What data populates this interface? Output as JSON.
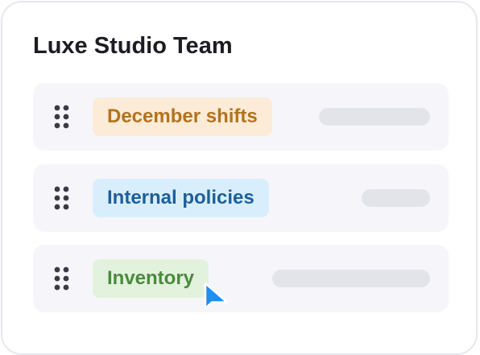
{
  "card": {
    "title": "Luxe Studio Team"
  },
  "rows": [
    {
      "label": "December shifts",
      "color": "#b2731e",
      "background": "#fcebd6"
    },
    {
      "label": "Internal policies",
      "color": "#1d5f99",
      "background": "#d9eefd"
    },
    {
      "label": "Inventory",
      "color": "#4b8a3f",
      "background": "#e2f2dc"
    }
  ],
  "icons": {
    "drag": "drag-handle-icon",
    "cursor": "mouse-pointer-icon"
  },
  "colors": {
    "accent_cursor": "#1e8ef0",
    "row_background": "#f6f6fa",
    "placeholder_bar": "#e3e4ea"
  }
}
